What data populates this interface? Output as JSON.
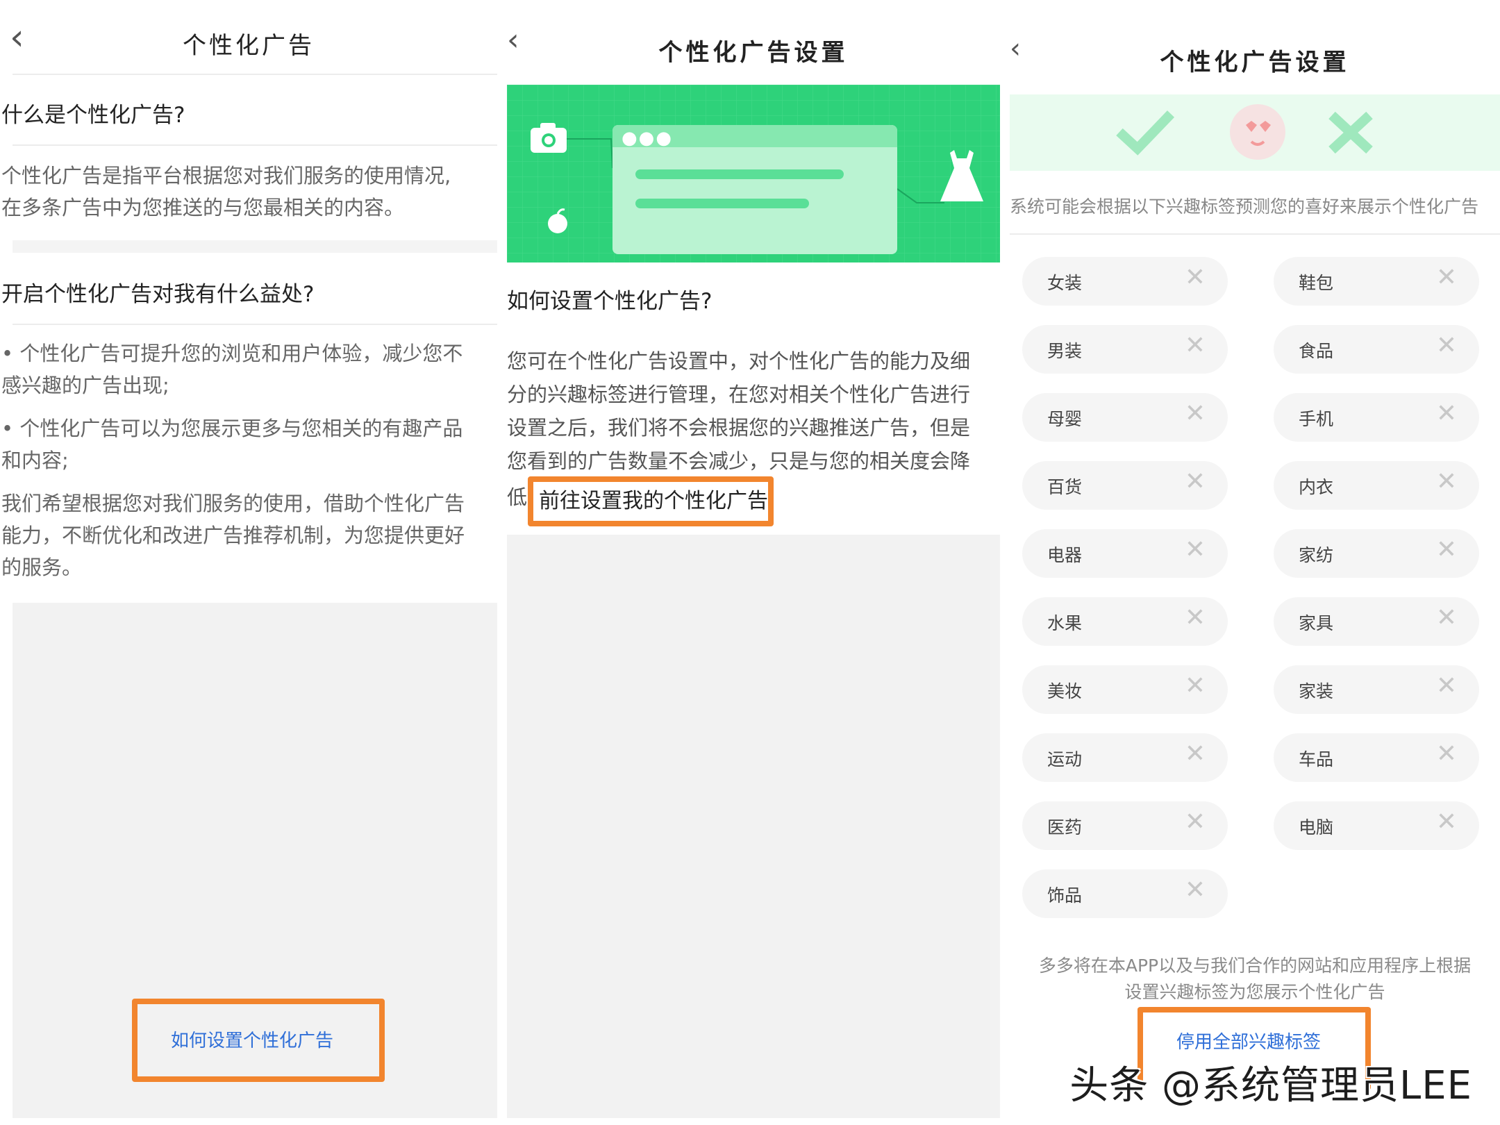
{
  "panel1": {
    "title": "个性化广告",
    "q1": "什么是个性化广告?",
    "a1_line1": "个性化广告是指平台根据您对我们服务的使用情况,",
    "a1_line2": "在多条广告中为您推送的与您最相关的内容。",
    "q2": "开启个性化广告对我有什么益处?",
    "b1_line1": "•  个性化广告可提升您的浏览和用户体验，减少您不",
    "b1_line2": "感兴趣的广告出现;",
    "b2_line1": "•  个性化广告可以为您展示更多与您相关的有趣产品",
    "b2_line2": "和内容;",
    "p_line1": "我们希望根据您对我们服务的使用，借助个性化广告",
    "p_line2": "能力，不断优化和改进广告推荐机制，为您提供更好",
    "p_line3": "的服务。",
    "link": "如何设置个性化广告"
  },
  "panel2": {
    "title": "个性化广告设置",
    "question": "如何设置个性化广告?",
    "line1": "您可在个性化广告设置中，对个性化广告的能力及细",
    "line2": "分的兴趣标签进行管理，在您对相关个性化广告进行",
    "line3": "设置之后，我们将不会根据您的兴趣推送广告，但是",
    "line4": "您看到的广告数量不会减少，只是与您的相关度会降",
    "line5_prefix": "低。",
    "link": "前往设置我的个性化广告"
  },
  "panel3": {
    "title": "个性化广告设置",
    "notice": "系统可能会根据以下兴趣标签预测您的喜好来展示个性化广告",
    "tags": [
      "女装",
      "鞋包",
      "男装",
      "食品",
      "母婴",
      "手机",
      "百货",
      "内衣",
      "电器",
      "家纺",
      "水果",
      "家具",
      "美妆",
      "家装",
      "运动",
      "车品",
      "医药",
      "电脑",
      "饰品"
    ],
    "remove_glyph": "✕",
    "footer_line1": "多多将在本APP以及与我们合作的网站和应用程序上根据",
    "footer_line2": "设置兴趣标签为您展示个性化广告",
    "link": "停用全部兴趣标签"
  },
  "watermark": "头条 @系统管理员LEE",
  "colors": {
    "highlight": "#f2852e",
    "link": "#2f6fd8",
    "banner_green": "#2ed27a"
  }
}
